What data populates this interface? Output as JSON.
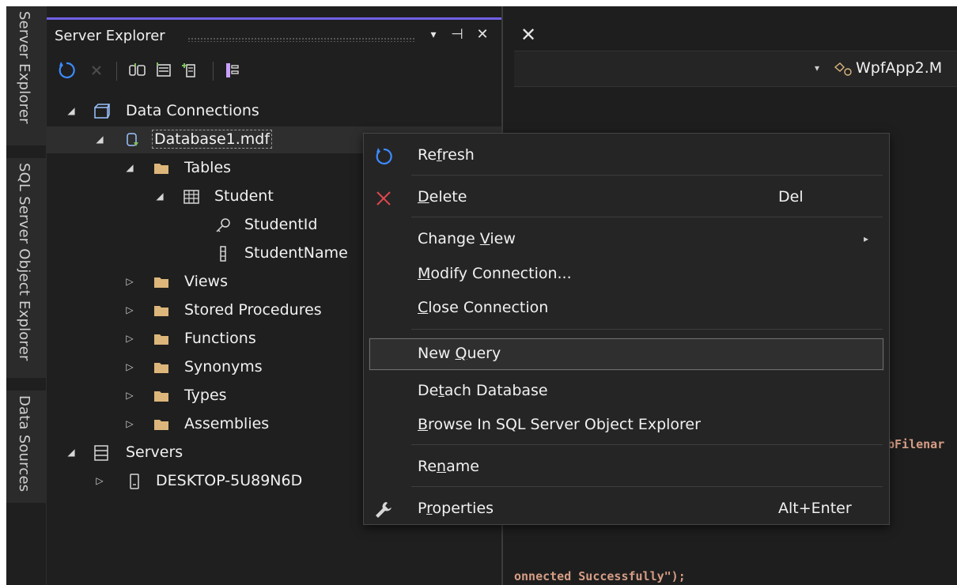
{
  "side_tabs": [
    "Server Explorer",
    "SQL Server Object Explorer",
    "Data Sources"
  ],
  "panel": {
    "title": "Server Explorer",
    "buttons": [
      "▾",
      "⊣",
      "✕"
    ]
  },
  "tree": [
    {
      "label": "Data Connections"
    },
    {
      "label": "Database1.mdf"
    },
    {
      "label": "Tables"
    },
    {
      "label": "Student"
    },
    {
      "label": "StudentId"
    },
    {
      "label": "StudentName"
    },
    {
      "label": "Views"
    },
    {
      "label": "Stored Procedures"
    },
    {
      "label": "Functions"
    },
    {
      "label": "Synonyms"
    },
    {
      "label": "Types"
    },
    {
      "label": "Assemblies"
    },
    {
      "label": "Servers"
    },
    {
      "label": "DESKTOP-5U89N6D"
    }
  ],
  "editor": {
    "close_glyph": "✕",
    "nav_dropdown": "▾",
    "nav_scope": "WpfApp2.M",
    "code_fragment_1": "bFilenar",
    "code_fragment_2": "onnected Successfully\");"
  },
  "context_menu": {
    "items": [
      {
        "pre": "Re",
        "ul": "f",
        "post": "resh",
        "shortcut": ""
      },
      {
        "pre": "",
        "ul": "D",
        "post": "elete",
        "shortcut": "Del"
      },
      {
        "pre": "Change ",
        "ul": "V",
        "post": "iew",
        "shortcut": ""
      },
      {
        "pre": "",
        "ul": "M",
        "post": "odify Connection...",
        "shortcut": ""
      },
      {
        "pre": "",
        "ul": "C",
        "post": "lose Connection",
        "shortcut": ""
      },
      {
        "pre": "New ",
        "ul": "Q",
        "post": "uery",
        "shortcut": ""
      },
      {
        "pre": "De",
        "ul": "t",
        "post": "ach Database",
        "shortcut": ""
      },
      {
        "pre": "",
        "ul": "B",
        "post": "rowse In SQL Server Object Explorer",
        "shortcut": ""
      },
      {
        "pre": "Re",
        "ul": "n",
        "post": "ame",
        "shortcut": ""
      },
      {
        "pre": "P",
        "ul": "r",
        "post": "operties",
        "shortcut": "Alt+Enter"
      }
    ],
    "submenu_arrow": "▸"
  },
  "colors": {
    "accent": "#7160e8",
    "refresh_icon": "#3d8bff",
    "delete_icon": "#e0474c",
    "folder": "#dcb67a",
    "code_string": "#d69d85"
  }
}
